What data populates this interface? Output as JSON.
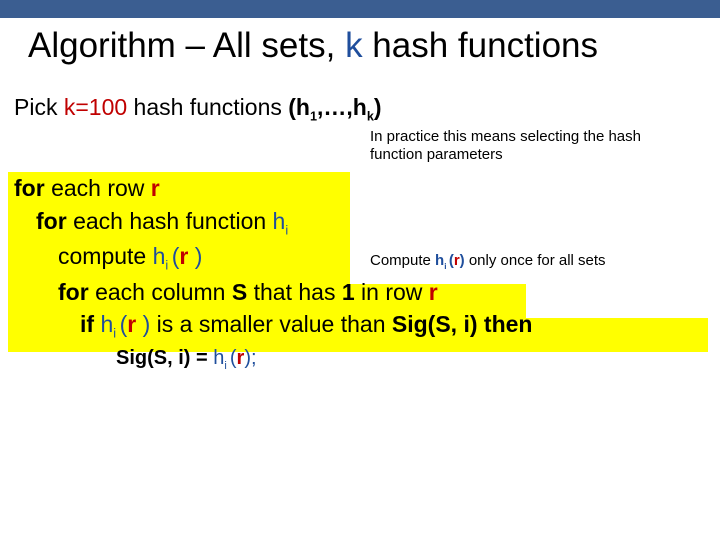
{
  "title": {
    "pre": "Algorithm – All sets, ",
    "k": "k",
    "post": " hash functions"
  },
  "pick": {
    "pre": "Pick ",
    "kval": "k=100",
    "mid": " hash functions ",
    "hlab_open": "(h",
    "hlab_one": "1",
    "hlab_mid": ",…,h",
    "hlab_k": "k",
    "hlab_close": ")"
  },
  "note1": "In practice this means selecting the hash function parameters",
  "note2": {
    "pre": "Compute ",
    "hi": "h",
    "sub_i": "i ",
    "open": "(",
    "r": "r",
    "close": ")",
    "post": " only once for all sets"
  },
  "algo": {
    "l1": {
      "for": "for ",
      "mid": "each row ",
      "r": "r"
    },
    "l2": {
      "for": "for ",
      "mid": "each hash function ",
      "h": "h",
      "i": "i"
    },
    "l3": {
      "pre": "compute ",
      "h": "h",
      "i": "i ",
      "open": "(",
      "r": "r",
      "close": " )"
    },
    "l4": {
      "for": "for ",
      "mid1": "each column ",
      "S": "S",
      "mid2": " that has ",
      "one": "1",
      "mid3": " in row ",
      "r": "r"
    },
    "l5": {
      "if": "if ",
      "h": "h",
      "i": "i ",
      "open": "(",
      "r": "r",
      "close": " ) ",
      "mid": "is a smaller value than ",
      "sig": "Sig(S, i)",
      "then": " then"
    },
    "l6": {
      "lhs": "Sig(S, i) = ",
      "h": "h",
      "i": "i ",
      "open": "(",
      "r": "r",
      "close": ");"
    }
  }
}
